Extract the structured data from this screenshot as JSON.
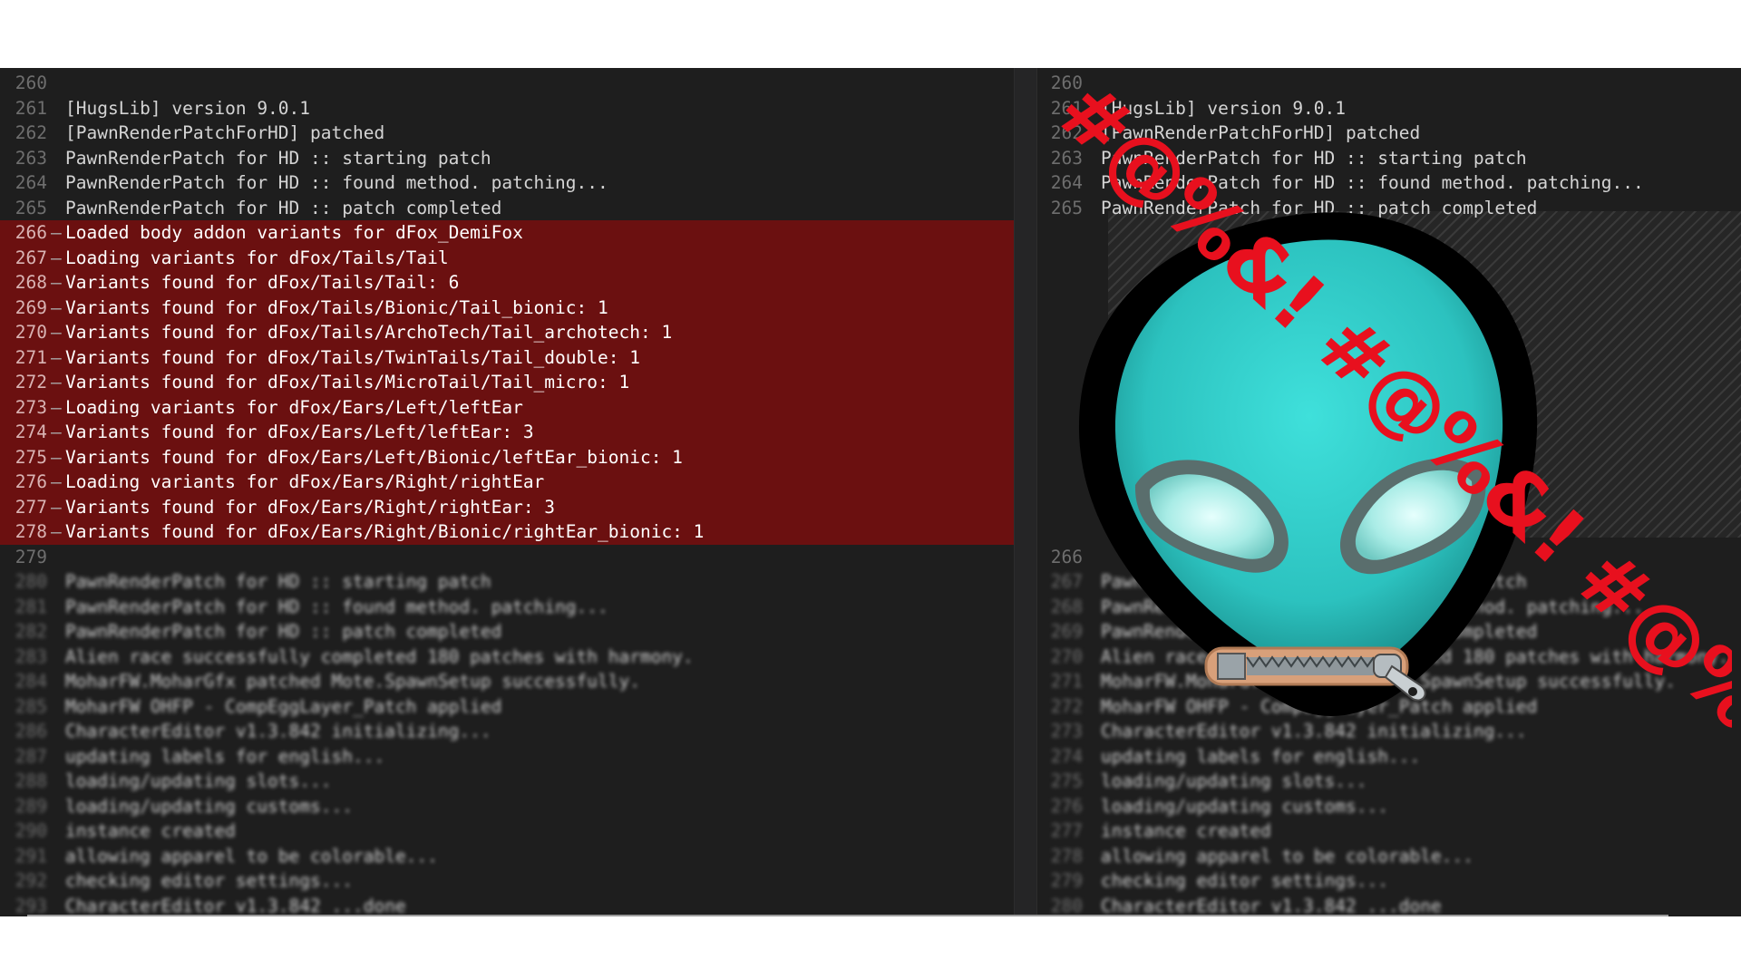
{
  "left_pane": {
    "lines": [
      {
        "no": "260",
        "text": "",
        "marker": "",
        "state": "normal"
      },
      {
        "no": "261",
        "text": "[HugsLib] version 9.0.1",
        "marker": "",
        "state": "normal"
      },
      {
        "no": "262",
        "text": "[PawnRenderPatchForHD] patched",
        "marker": "",
        "state": "normal"
      },
      {
        "no": "263",
        "text": "PawnRenderPatch for HD :: starting patch",
        "marker": "",
        "state": "normal"
      },
      {
        "no": "264",
        "text": "PawnRenderPatch for HD :: found method. patching...",
        "marker": "",
        "state": "normal"
      },
      {
        "no": "265",
        "text": "PawnRenderPatch for HD :: patch completed",
        "marker": "",
        "state": "normal"
      },
      {
        "no": "266",
        "text": "Loaded body addon variants for dFox_DemiFox",
        "marker": "—",
        "state": "added"
      },
      {
        "no": "267",
        "text": "Loading variants for dFox/Tails/Tail",
        "marker": "—",
        "state": "added"
      },
      {
        "no": "268",
        "text": "Variants found for dFox/Tails/Tail: 6",
        "marker": "—",
        "state": "added"
      },
      {
        "no": "269",
        "text": "Variants found for dFox/Tails/Bionic/Tail_bionic: 1",
        "marker": "—",
        "state": "added"
      },
      {
        "no": "270",
        "text": "Variants found for dFox/Tails/ArchoTech/Tail_archotech: 1",
        "marker": "—",
        "state": "added"
      },
      {
        "no": "271",
        "text": "Variants found for dFox/Tails/TwinTails/Tail_double: 1",
        "marker": "—",
        "state": "added"
      },
      {
        "no": "272",
        "text": "Variants found for dFox/Tails/MicroTail/Tail_micro: 1",
        "marker": "—",
        "state": "added"
      },
      {
        "no": "273",
        "text": "Loading variants for dFox/Ears/Left/leftEar",
        "marker": "—",
        "state": "added"
      },
      {
        "no": "274",
        "text": "Variants found for dFox/Ears/Left/leftEar: 3",
        "marker": "—",
        "state": "added"
      },
      {
        "no": "275",
        "text": "Variants found for dFox/Ears/Left/Bionic/leftEar_bionic: 1",
        "marker": "—",
        "state": "added"
      },
      {
        "no": "276",
        "text": "Loading variants for dFox/Ears/Right/rightEar",
        "marker": "—",
        "state": "added"
      },
      {
        "no": "277",
        "text": "Variants found for dFox/Ears/Right/rightEar: 3",
        "marker": "—",
        "state": "added"
      },
      {
        "no": "278",
        "text": "Variants found for dFox/Ears/Right/Bionic/rightEar_bionic: 1",
        "marker": "—",
        "state": "added"
      },
      {
        "no": "279",
        "text": "",
        "marker": "",
        "state": "normal"
      },
      {
        "no": "280",
        "text": "PawnRenderPatch for HD :: starting patch",
        "marker": "",
        "state": "blurred"
      },
      {
        "no": "281",
        "text": "PawnRenderPatch for HD :: found method. patching...",
        "marker": "",
        "state": "blurred"
      },
      {
        "no": "282",
        "text": "PawnRenderPatch for HD :: patch completed",
        "marker": "",
        "state": "blurred"
      },
      {
        "no": "283",
        "text": "Alien race successfully completed 180 patches with harmony.",
        "marker": "",
        "state": "blurred"
      },
      {
        "no": "284",
        "text": "MoharFW.MoharGfx patched Mote.SpawnSetup successfully.",
        "marker": "",
        "state": "blurred"
      },
      {
        "no": "285",
        "text": "MoharFW OHFP - CompEggLayer_Patch applied",
        "marker": "",
        "state": "blurred"
      },
      {
        "no": "286",
        "text": "CharacterEditor v1.3.842 initializing...",
        "marker": "",
        "state": "blurred"
      },
      {
        "no": "287",
        "text": "updating labels for english...",
        "marker": "",
        "state": "blurred"
      },
      {
        "no": "288",
        "text": "loading/updating slots...",
        "marker": "",
        "state": "blurred"
      },
      {
        "no": "289",
        "text": "loading/updating customs...",
        "marker": "",
        "state": "blurred"
      },
      {
        "no": "290",
        "text": "instance created",
        "marker": "",
        "state": "blurred"
      },
      {
        "no": "291",
        "text": "allowing apparel to be colorable...",
        "marker": "",
        "state": "blurred"
      },
      {
        "no": "292",
        "text": "checking editor settings...",
        "marker": "",
        "state": "blurred"
      },
      {
        "no": "293",
        "text": "CharacterEditor v1.3.842 ...done",
        "marker": "",
        "state": "blurred"
      }
    ]
  },
  "right_pane": {
    "top_lines": [
      {
        "no": "260",
        "text": "",
        "state": "normal"
      },
      {
        "no": "261",
        "text": "[HugsLib] version 9.0.1",
        "state": "normal"
      },
      {
        "no": "262",
        "text": "[PawnRenderPatchForHD] patched",
        "state": "normal"
      },
      {
        "no": "263",
        "text": "PawnRenderPatch for HD :: starting patch",
        "state": "normal"
      },
      {
        "no": "264",
        "text": "PawnRenderPatch for HD :: found method. patching...",
        "state": "normal"
      },
      {
        "no": "265",
        "text": "PawnRenderPatch for HD :: patch completed",
        "state": "normal"
      }
    ],
    "bottom_lines": [
      {
        "no": "266",
        "text": "",
        "state": "normal"
      },
      {
        "no": "267",
        "text": "PawnRenderPatch for HD :: starting patch",
        "state": "blurred"
      },
      {
        "no": "268",
        "text": "PawnRenderPatch for HD :: found method. patching...",
        "state": "blurred"
      },
      {
        "no": "269",
        "text": "PawnRenderPatch for HD :: patch completed",
        "state": "blurred"
      },
      {
        "no": "270",
        "text": "Alien race successfully completed 180 patches with harmony.",
        "state": "blurred"
      },
      {
        "no": "271",
        "text": "MoharFW.MoharGfx patched Mote.SpawnSetup successfully.",
        "state": "blurred"
      },
      {
        "no": "272",
        "text": "MoharFW OHFP - CompEggLayer_Patch applied",
        "state": "blurred"
      },
      {
        "no": "273",
        "text": "CharacterEditor v1.3.842 initializing...",
        "state": "blurred"
      },
      {
        "no": "274",
        "text": "updating labels for english...",
        "state": "blurred"
      },
      {
        "no": "275",
        "text": "loading/updating slots...",
        "state": "blurred"
      },
      {
        "no": "276",
        "text": "loading/updating customs...",
        "state": "blurred"
      },
      {
        "no": "277",
        "text": "instance created",
        "state": "blurred"
      },
      {
        "no": "278",
        "text": "allowing apparel to be colorable...",
        "state": "blurred"
      },
      {
        "no": "279",
        "text": "checking editor settings...",
        "state": "blurred"
      },
      {
        "no": "280",
        "text": "CharacterEditor v1.3.842 ...done",
        "state": "blurred"
      }
    ]
  },
  "overlay": {
    "censor_text": "#@%&! #@%&! #@%&!",
    "censor_color": "#e8101e",
    "face_color": "#2ec9c6",
    "outline_color": "#000000",
    "zipper_icon": "zipper-icon"
  },
  "colors": {
    "editor_bg": "#1e1e1e",
    "added_bg": "#6b1010",
    "line_number": "#6e6e6e",
    "text": "#d4d4d4"
  }
}
